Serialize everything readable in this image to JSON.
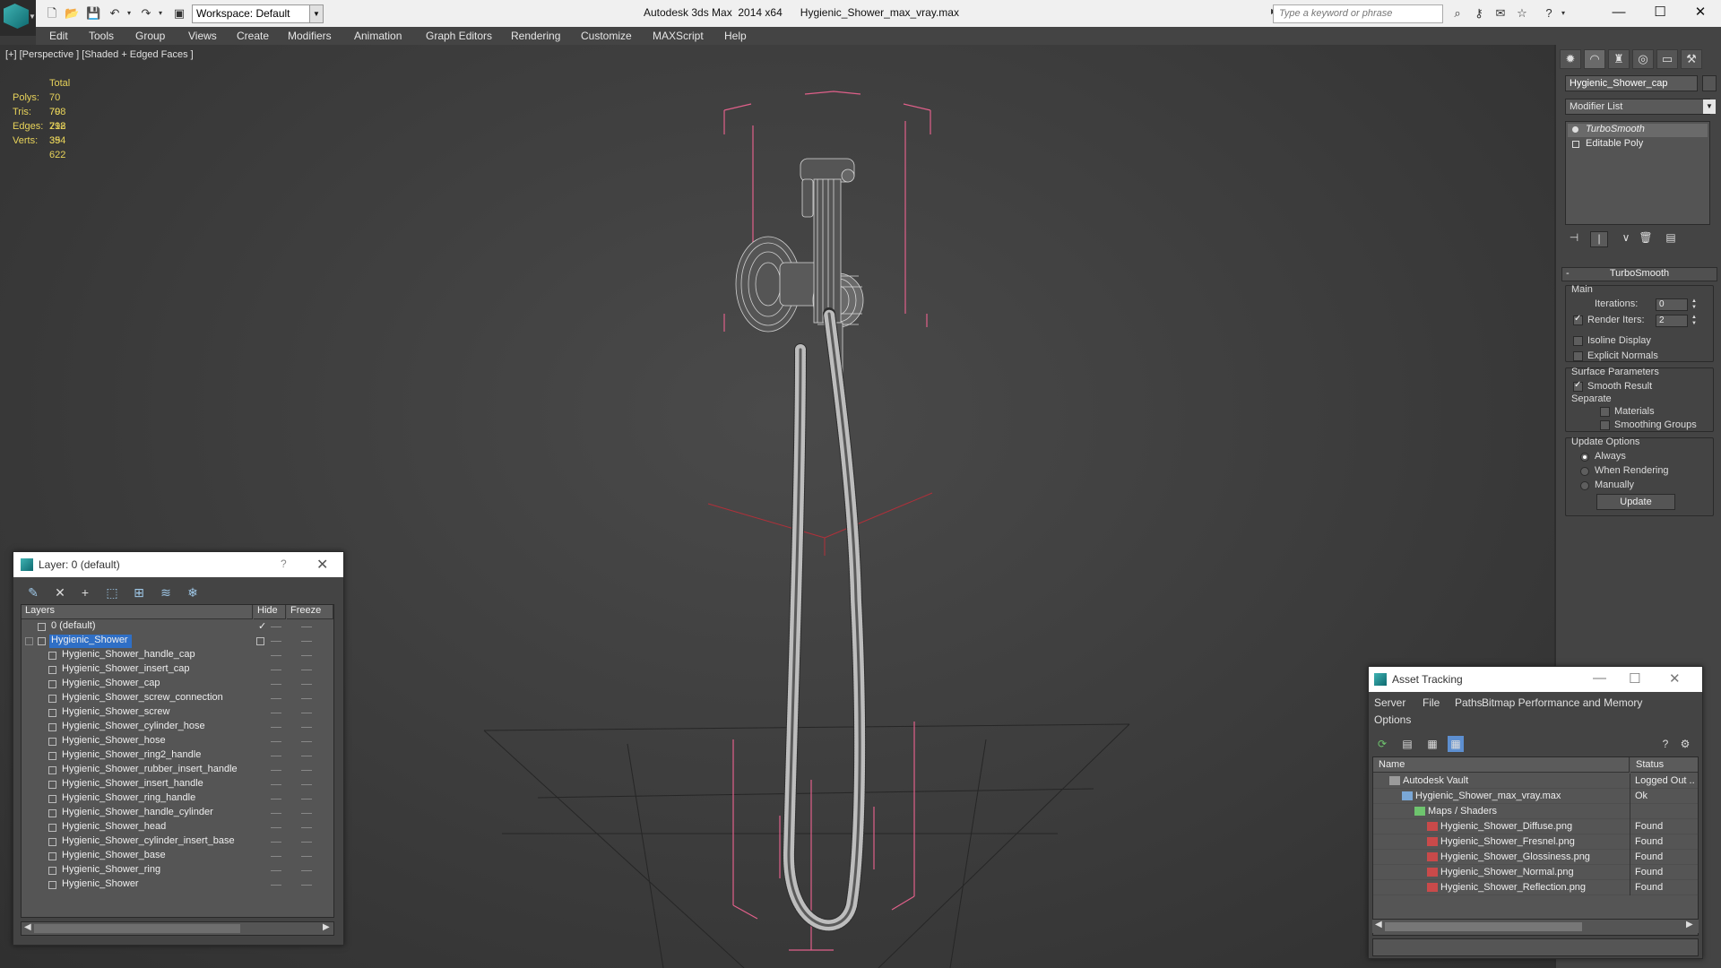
{
  "titlebar": {
    "workspace": "Workspace: Default",
    "app_title": "Autodesk 3ds Max  2014 x64",
    "file_title": "Hygienic_Shower_max_vray.max",
    "search_placeholder": "Type a keyword or phrase"
  },
  "menu": [
    "Edit",
    "Tools",
    "Group",
    "Views",
    "Create",
    "Modifiers",
    "Animation",
    "Graph Editors",
    "Rendering",
    "Customize",
    "MAXScript",
    "Help"
  ],
  "viewport": {
    "label": "[+] [Perspective ] [Shaded + Edged Faces ]",
    "stats": {
      "header": "Total",
      "rows": [
        {
          "label": "Polys:",
          "value": "70 798"
        },
        {
          "label": "Tris:",
          "value": "70 798"
        },
        {
          "label": "Edges:",
          "value": "212 394"
        },
        {
          "label": "Verts:",
          "value": "35 622"
        }
      ]
    }
  },
  "command_panel": {
    "object_name": "Hygienic_Shower_cap",
    "modifier_list": "Modifier List",
    "stack": [
      "TurboSmooth",
      "Editable Poly"
    ],
    "rollout_title": "TurboSmooth",
    "main_group": "Main",
    "iterations_label": "Iterations:",
    "iterations_value": "0",
    "render_iters_label": "Render Iters:",
    "render_iters_value": "2",
    "isoline_label": "Isoline Display",
    "explicit_normals_label": "Explicit Normals",
    "surface_group": "Surface Parameters",
    "smooth_result_label": "Smooth Result",
    "separate_label": "Separate",
    "materials_label": "Materials",
    "smoothing_groups_label": "Smoothing Groups",
    "update_group": "Update Options",
    "always_label": "Always",
    "when_rendering_label": "When Rendering",
    "manually_label": "Manually",
    "update_button": "Update"
  },
  "layer_dialog": {
    "title": "Layer: 0 (default)",
    "help": "?",
    "columns": [
      "Layers",
      "Hide",
      "Freeze"
    ],
    "rows": [
      {
        "name": "0 (default)",
        "level": 1,
        "selected": false
      },
      {
        "name": "Hygienic_Shower",
        "level": 1,
        "selected": true
      },
      {
        "name": "Hygienic_Shower_handle_cap",
        "level": 2,
        "selected": false
      },
      {
        "name": "Hygienic_Shower_insert_cap",
        "level": 2,
        "selected": false
      },
      {
        "name": "Hygienic_Shower_cap",
        "level": 2,
        "selected": false
      },
      {
        "name": "Hygienic_Shower_screw_connection",
        "level": 2,
        "selected": false
      },
      {
        "name": "Hygienic_Shower_screw",
        "level": 2,
        "selected": false
      },
      {
        "name": "Hygienic_Shower_cylinder_hose",
        "level": 2,
        "selected": false
      },
      {
        "name": "Hygienic_Shower_hose",
        "level": 2,
        "selected": false
      },
      {
        "name": "Hygienic_Shower_ring2_handle",
        "level": 2,
        "selected": false
      },
      {
        "name": "Hygienic_Shower_rubber_insert_handle",
        "level": 2,
        "selected": false
      },
      {
        "name": "Hygienic_Shower_insert_handle",
        "level": 2,
        "selected": false
      },
      {
        "name": "Hygienic_Shower_ring_handle",
        "level": 2,
        "selected": false
      },
      {
        "name": "Hygienic_Shower_handle_cylinder",
        "level": 2,
        "selected": false
      },
      {
        "name": "Hygienic_Shower_head",
        "level": 2,
        "selected": false
      },
      {
        "name": "Hygienic_Shower_cylinder_insert_base",
        "level": 2,
        "selected": false
      },
      {
        "name": "Hygienic_Shower_base",
        "level": 2,
        "selected": false
      },
      {
        "name": "Hygienic_Shower_ring",
        "level": 2,
        "selected": false
      },
      {
        "name": "Hygienic_Shower",
        "level": 2,
        "selected": false
      }
    ]
  },
  "asset_dialog": {
    "title": "Asset Tracking",
    "menu": [
      "Server",
      "File",
      "Paths",
      "Bitmap Performance and Memory",
      "Options"
    ],
    "columns": [
      "Name",
      "Status"
    ],
    "rows": [
      {
        "name": "Autodesk Vault",
        "status": "Logged Out ..",
        "level": 0,
        "icon": "vault-icon"
      },
      {
        "name": "Hygienic_Shower_max_vray.max",
        "status": "Ok",
        "level": 1,
        "icon": "max-file-icon"
      },
      {
        "name": "Maps / Shaders",
        "status": "",
        "level": 2,
        "icon": "maps-folder-icon"
      },
      {
        "name": "Hygienic_Shower_Diffuse.png",
        "status": "Found",
        "level": 3,
        "icon": "png-icon"
      },
      {
        "name": "Hygienic_Shower_Fresnel.png",
        "status": "Found",
        "level": 3,
        "icon": "png-icon"
      },
      {
        "name": "Hygienic_Shower_Glossiness.png",
        "status": "Found",
        "level": 3,
        "icon": "png-icon"
      },
      {
        "name": "Hygienic_Shower_Normal.png",
        "status": "Found",
        "level": 3,
        "icon": "png-icon"
      },
      {
        "name": "Hygienic_Shower_Reflection.png",
        "status": "Found",
        "level": 3,
        "icon": "png-icon"
      }
    ]
  },
  "colors": {
    "stats_text": "#e8d35a",
    "selection": "#2f6fc6",
    "bounding_box": "#e0608a",
    "wireframe": "#d8d8d8"
  }
}
